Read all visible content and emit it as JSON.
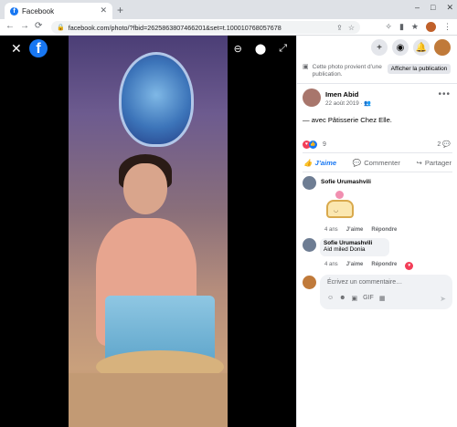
{
  "browser": {
    "tab_title": "Facebook",
    "tab_close": "✕",
    "new_tab": "+",
    "window_controls": [
      "–",
      "□",
      "✕"
    ],
    "back": "←",
    "forward": "→",
    "reload": "⟳",
    "url": "facebook.com/photo/?fbid=2625863807466201&set=t.100010768057678",
    "omni_icons": [
      "⇪",
      "☆"
    ],
    "ext_icons": [
      "✧",
      "▮",
      "★"
    ]
  },
  "viewer": {
    "close": "✕",
    "logo": "f",
    "tools": [
      "⊕",
      "⊖",
      "⬤",
      "⤢"
    ]
  },
  "panel": {
    "top_icons": [
      "+",
      "◉",
      "🔔"
    ],
    "notice_text": "Cette photo provient d’une publication.",
    "show_post_label": "Afficher la publication",
    "post": {
      "author": "Imen Abid",
      "date": "22 août 2019 · ",
      "more": "•••",
      "text": "— avec Pâtisserie Chez Elle."
    },
    "reactions": {
      "count": "9",
      "comments_count": "2"
    },
    "actions": {
      "like": "J’aime",
      "comment": "Commenter",
      "share": "Partager"
    },
    "comments": [
      {
        "author": "Sofie Urumashvili",
        "meta": {
          "age": "4 ans",
          "like": "J’aime",
          "reply": "Répondre"
        }
      },
      {
        "author": "Sofie Urumashvili",
        "text": "Aid miled Donia",
        "meta": {
          "age": "4 ans",
          "like": "J’aime",
          "reply": "Répondre"
        }
      }
    ],
    "write_placeholder": "Écrivez un commentaire…",
    "write_tools": [
      "☺",
      "☻",
      "▣",
      "GIF",
      "▦"
    ],
    "send": "➤"
  },
  "colors": {
    "facebook_blue": "#1877f2",
    "love_red": "#f33e58"
  }
}
